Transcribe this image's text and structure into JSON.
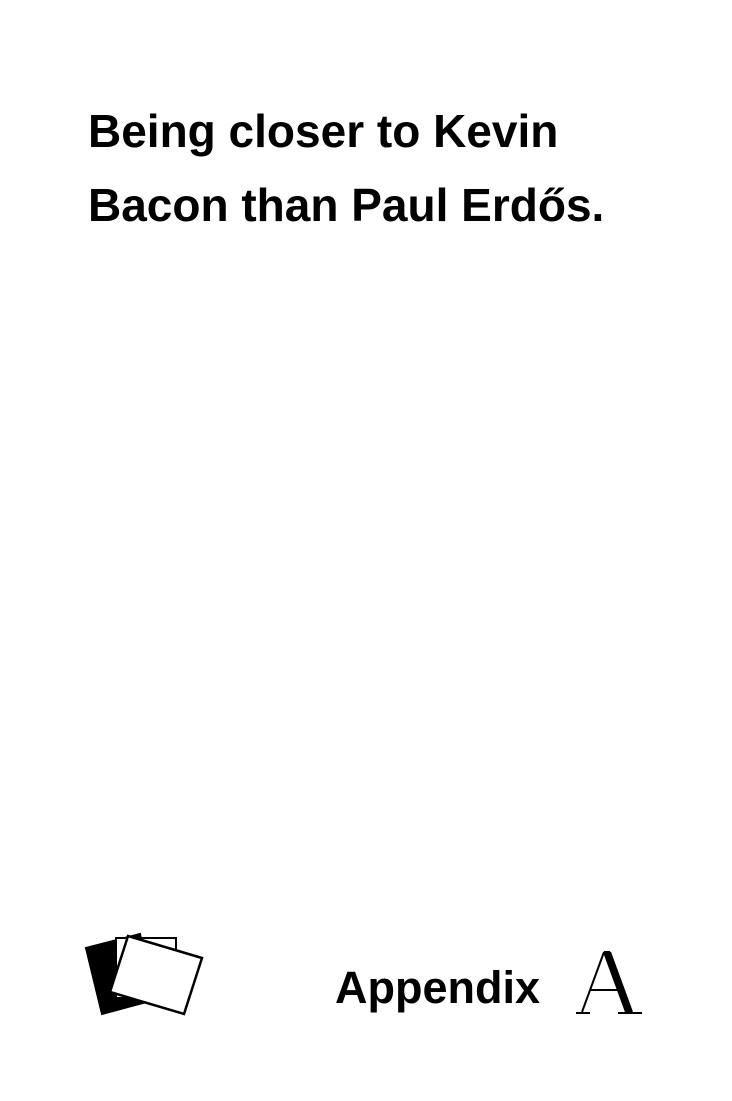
{
  "card": {
    "text": "Being closer to Kevin Bacon than Paul Erdős.",
    "expansion_label": "Appendix",
    "expansion_icon": "double-struck-a-icon",
    "logo_icon": "stacked-cards-icon",
    "colors": {
      "background": "#ffffff",
      "ink": "#000000"
    }
  }
}
